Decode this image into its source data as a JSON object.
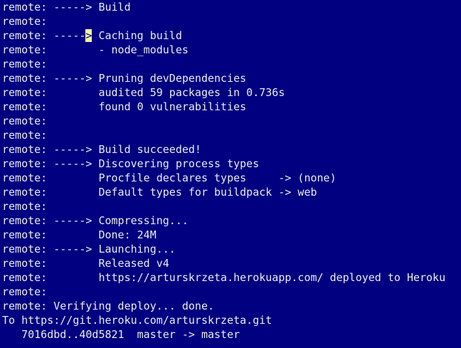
{
  "terminal": {
    "lines": [
      "remote: -----> Build",
      "remote:",
      "remote: -----> Caching build",
      "remote:        - node_modules",
      "remote:",
      "remote: -----> Pruning devDependencies",
      "remote:        audited 59 packages in 0.736s",
      "remote:        found 0 vulnerabilities",
      "remote:",
      "remote:",
      "remote: -----> Build succeeded!",
      "remote: -----> Discovering process types",
      "remote:        Procfile declares types     -> (none)",
      "remote:        Default types for buildpack -> web",
      "remote:",
      "remote: -----> Compressing...",
      "remote:        Done: 24M",
      "remote: -----> Launching...",
      "remote:        Released v4",
      "remote:        https://arturskrzeta.herokuapp.com/ deployed to Heroku",
      "remote:",
      "remote: Verifying deploy... done.",
      "To https://git.heroku.com/arturskrzeta.git",
      "   7016dbd..40d5821  master -> master"
    ],
    "cursor": {
      "line_index": 2,
      "char_index": 13
    },
    "colors": {
      "background": "#000080",
      "foreground": "#eaeaea",
      "cursor": "#f5f5a0"
    }
  }
}
